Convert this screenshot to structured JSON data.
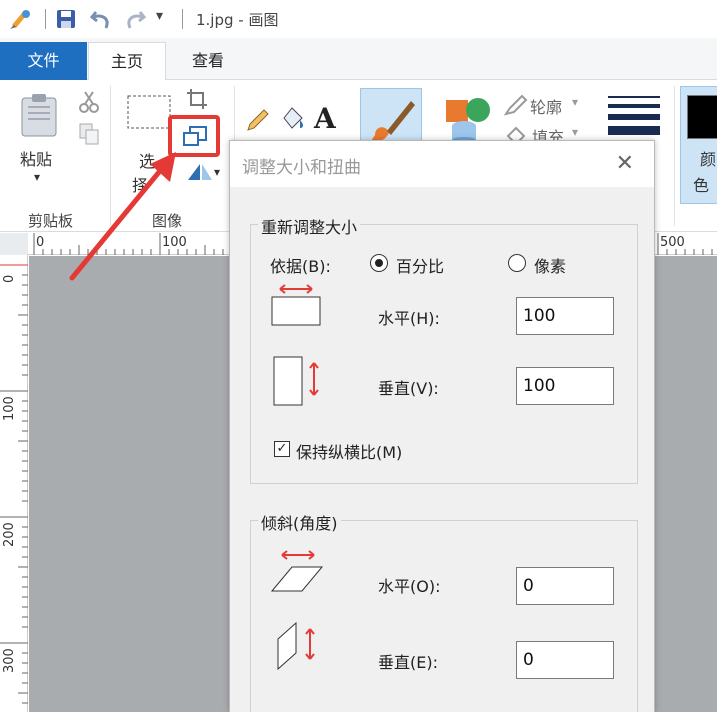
{
  "title_bar": {
    "title": "1.jpg - 画图",
    "dropdown_glyph": "▾"
  },
  "tabs": [
    {
      "label": "文件"
    },
    {
      "label": "主页"
    },
    {
      "label": "查看"
    }
  ],
  "ribbon": {
    "clipboard": {
      "paste_label": "粘贴",
      "group_label": "剪贴板"
    },
    "image": {
      "select_label_line1": "选",
      "select_label_line2": "择",
      "group_label": "图像"
    },
    "shapes": {
      "outline_label": "轮廓",
      "fill_label": "填充"
    },
    "colors": {
      "color_label_line1": "颜",
      "color_label_line2": "色"
    }
  },
  "ruler": {
    "top": [
      "0",
      "100",
      "500"
    ],
    "left": [
      "0",
      "100",
      "200",
      "300"
    ]
  },
  "dialog": {
    "title": "调整大小和扭曲",
    "close_glyph": "✕",
    "resize": {
      "legend": "重新调整大小",
      "by_label": "依据(B):",
      "option_percent": "百分比",
      "option_pixels": "像素",
      "selected": "百分比",
      "horizontal_label": "水平(H):",
      "horizontal_value": "100",
      "vertical_label": "垂直(V):",
      "vertical_value": "100",
      "keep_ratio_label": "保持纵横比(M)",
      "keep_ratio_checked": true
    },
    "skew": {
      "legend": "倾斜(角度)",
      "horizontal_label": "水平(O):",
      "horizontal_value": "0",
      "vertical_label": "垂直(E):",
      "vertical_value": "0"
    }
  },
  "colors": {
    "file_tab_bg": "#1e6fc0",
    "highlight": "#e53935"
  }
}
